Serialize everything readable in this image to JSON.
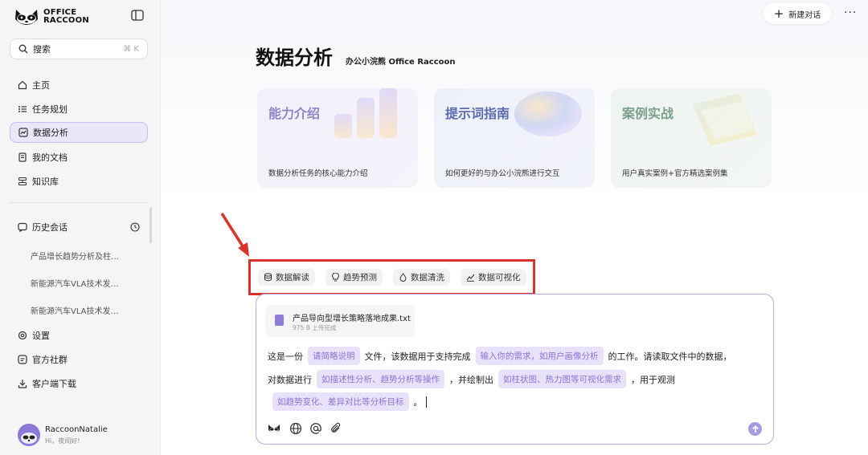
{
  "brand": {
    "line1": "OFFICE",
    "line2": "RACCOON"
  },
  "search": {
    "label": "搜索",
    "shortcut": "⌘ K"
  },
  "sidebar": {
    "items": [
      {
        "label": "主页",
        "icon": "home-icon"
      },
      {
        "label": "任务规划",
        "icon": "list-icon"
      },
      {
        "label": "数据分析",
        "icon": "chart-icon",
        "active": true
      },
      {
        "label": "我的文档",
        "icon": "document-icon"
      },
      {
        "label": "知识库",
        "icon": "database-icon"
      }
    ],
    "history_title": "历史会话",
    "history": [
      "产品增长趋势分析及柱…",
      "新能源汽车VLA技术发…",
      "新能源汽车VLA技术发…"
    ],
    "bottom_items": [
      {
        "label": "设置",
        "icon": "gear-icon"
      },
      {
        "label": "官方社群",
        "icon": "community-icon"
      },
      {
        "label": "客户端下载",
        "icon": "download-icon"
      }
    ]
  },
  "user": {
    "name": "RaccoonNatalie",
    "greeting": "Hi，夜间好!"
  },
  "header": {
    "new_chat": "新建对话",
    "more": "···"
  },
  "page": {
    "title": "数据分析",
    "subtitle": "办公小浣熊 Office Raccoon"
  },
  "cards": [
    {
      "title": "能力介绍",
      "desc": "数据分析任务的核心能力介绍"
    },
    {
      "title": "提示词指南",
      "desc": "如何更好的与办公小浣熊进行交互"
    },
    {
      "title": "案例实战",
      "desc": "用户真实案例+官方精选案例集"
    }
  ],
  "chips": [
    {
      "label": "数据解读",
      "icon": "database-icon"
    },
    {
      "label": "趋势预测",
      "icon": "lightbulb-icon"
    },
    {
      "label": "数据清洗",
      "icon": "droplet-icon"
    },
    {
      "label": "数据可视化",
      "icon": "line-chart-icon"
    }
  ],
  "file": {
    "name": "产品导向型增长策略落地成果.txt",
    "meta": "975 B 上传完成"
  },
  "prompt": {
    "l1_a": "这是一份",
    "l1_slot1": "请简略说明",
    "l1_b": "文件，该数据用于支持完成",
    "l1_slot2": "输入你的需求，如用户画像分析",
    "l1_c": "的工作。请读取文件中的数据，",
    "l2_a": "对数据进行",
    "l2_slot1": "如描述性分析、趋势分析等操作",
    "l2_b": "，并绘制出",
    "l2_slot2": "如柱状图、热力图等可视化需求",
    "l2_c": "，用于观测",
    "l3_slot1": "如趋势变化、差异对比等分析目标",
    "l3_a": "。"
  },
  "colors": {
    "accent": "#8a74d6",
    "highlight_box": "#d9342b",
    "slot_bg": "#e8e1fa"
  }
}
